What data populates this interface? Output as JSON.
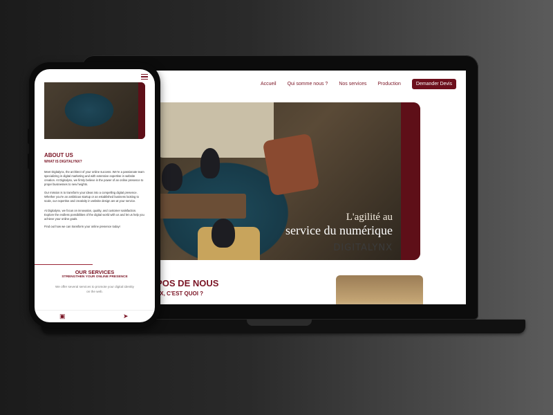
{
  "desktop": {
    "nav": [
      {
        "label": "Accueil"
      },
      {
        "label": "Qui somme nous ?"
      },
      {
        "label": "Nos services"
      },
      {
        "label": "Production"
      }
    ],
    "cta_label": "Demander Devis",
    "hero": {
      "line1": "L'agilité au",
      "line2": "service du numérique",
      "logo_text": "DIGITALYNX"
    },
    "about_title": "OPOS DE NOUS",
    "about_subtitle": "LYNX, C'EST QUOI ?"
  },
  "mobile": {
    "about_title": "ABOUT US",
    "about_subtitle": "WHAT IS DIGITALYNX?",
    "paragraphs": [
      "Meet Digitalynx, the architect of your online success. We're a passionate team specializing in digital marketing and with extensive expertise in website creation. At Digitalynx, we firmly believe in the power of an online presence to propel businesses to new heights.",
      "Our mission is to transform your ideas into a compelling digital presence. Whether you're an ambitious startup or an established business looking to scale, our expertise and creativity in website design are at your service.",
      "At Digitalynx, we focus on innovation, quality, and customer satisfaction. Explore the endless possibilities of the digital world with us and let us help you achieve your online goals.",
      "Find out how we can transform your online presence today!"
    ],
    "services_title": "OUR SERVICES",
    "services_subtitle": "STRENGTHEN YOUR ONLINE PRESENCE",
    "services_text": "We offer several services to promote your digital identity on the web."
  },
  "colors": {
    "accent": "#7a1424",
    "cta": "#6d0f1c"
  }
}
